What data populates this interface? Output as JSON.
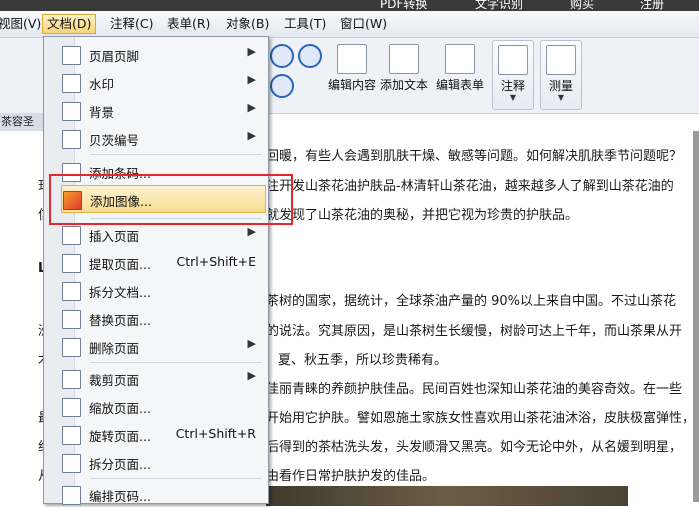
{
  "top_strip": {
    "items": [
      "PDF转换",
      "文字识别",
      "购买",
      "注册"
    ]
  },
  "menubar": {
    "items": [
      "视图(V)",
      "文档(D)",
      "注释(C)",
      "表单(R)",
      "对象(B)",
      "工具(T)",
      "窗口(W)"
    ],
    "active": "文档(D)"
  },
  "toolbar": {
    "buttons": [
      "编辑内容",
      "添加文本",
      "编辑表单",
      "注释",
      "测量"
    ]
  },
  "tab": {
    "label": "茶容圣品-"
  },
  "document": {
    "lines": [
      "回暖，有些人会遇到肌肤干燥、敏感等问题。如何解决肌肤季节问题呢？",
      "注开发山茶花油护肤品-林清轩山茶花油，越来越多人了解到山茶花油的",
      "就发现了山茶花油的奥秘，并把它视为珍贵的护肤品。",
      "茶树的国家，据统计，全球茶油产量的 90%以上来自中国。不过山茶花",
      "的说法。究其原因，是山茶树生长缓慢，树龄可达上千年，而山茶果从开",
      "夏、秋五季，所以珍贵稀有。",
      "佳丽青睐的养颜护肤佳品。民间百姓也深知山茶花油的美容奇效。在一些",
      "开始用它护肤。譬如恩施土家族女性喜欢用山茶花油沐浴，皮肤极富弹性，",
      "后得到的茶枯洗头发，头发顺滑又黑亮。如今无论中外，从名媛到明星，",
      "由看作日常护肤护发的佳品。"
    ],
    "left_chars": [
      "珏",
      "信",
      "L",
      "洲",
      "术",
      "最",
      "约",
      "从"
    ]
  },
  "dropdown": {
    "items": [
      {
        "label": "页眉页脚",
        "shortcut": "",
        "submenu": true,
        "icon": "header-footer-icon"
      },
      {
        "label": "水印",
        "shortcut": "",
        "submenu": true,
        "icon": "watermark-icon"
      },
      {
        "label": "背景",
        "shortcut": "",
        "submenu": true,
        "icon": "background-icon"
      },
      {
        "label": "贝茨编号",
        "shortcut": "",
        "submenu": true,
        "icon": "bates-number-icon"
      },
      {
        "label": "添加条码...",
        "shortcut": "",
        "submenu": false,
        "icon": "barcode-icon"
      },
      {
        "label": "添加图像...",
        "shortcut": "",
        "submenu": false,
        "icon": "add-image-icon"
      },
      {
        "label": "插入页面",
        "shortcut": "",
        "submenu": true,
        "icon": "insert-page-icon"
      },
      {
        "label": "提取页面...",
        "shortcut": "Ctrl+Shift+E",
        "submenu": false,
        "icon": "extract-page-icon"
      },
      {
        "label": "拆分文档...",
        "shortcut": "",
        "submenu": false,
        "icon": "split-document-icon"
      },
      {
        "label": "替换页面...",
        "shortcut": "",
        "submenu": false,
        "icon": "replace-page-icon"
      },
      {
        "label": "删除页面",
        "shortcut": "",
        "submenu": true,
        "icon": "delete-page-icon"
      },
      {
        "label": "裁剪页面",
        "shortcut": "",
        "submenu": true,
        "icon": "crop-page-icon"
      },
      {
        "label": "缩放页面...",
        "shortcut": "",
        "submenu": false,
        "icon": "scale-page-icon"
      },
      {
        "label": "旋转页面...",
        "shortcut": "Ctrl+Shift+R",
        "submenu": false,
        "icon": "rotate-page-icon"
      },
      {
        "label": "拆分页面...",
        "shortcut": "",
        "submenu": false,
        "icon": "split-page-icon"
      },
      {
        "label": "编排页码...",
        "shortcut": "",
        "submenu": false,
        "icon": "page-numbering-icon"
      }
    ],
    "highlighted": "添加图像..."
  },
  "colors": {
    "highlight_border": "#e8262b",
    "menu_hover": "#f8dd8f"
  }
}
